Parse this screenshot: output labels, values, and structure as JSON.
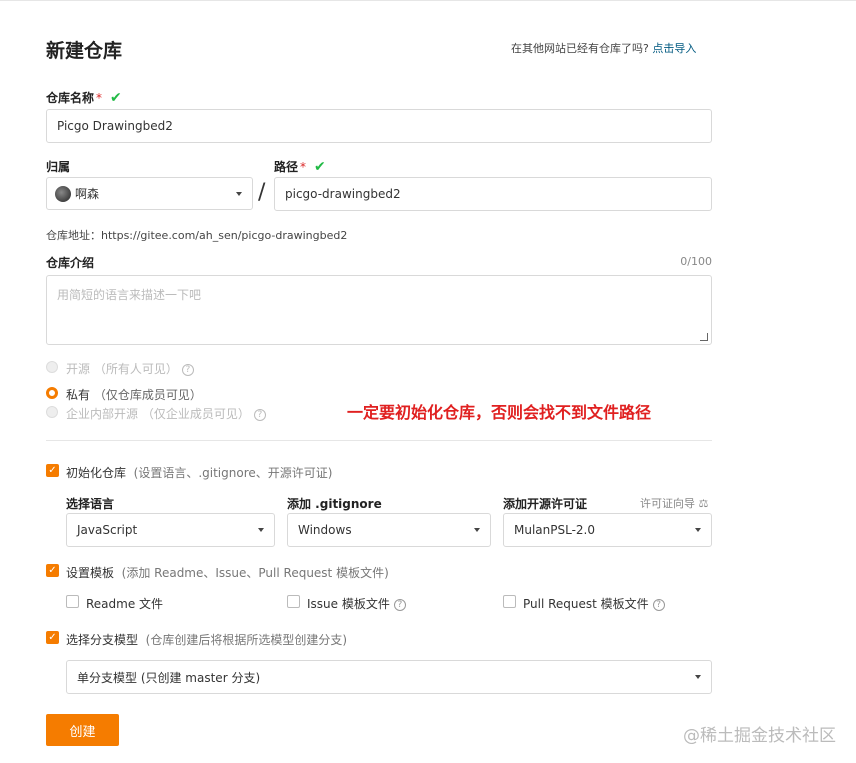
{
  "page": {
    "title": "新建仓库",
    "import_text": "在其他网站已经有仓库了吗?",
    "import_link": "点击导入"
  },
  "repo_name": {
    "label": "仓库名称",
    "required_mark": "*",
    "value": "Picgo Drawingbed2"
  },
  "owner": {
    "label": "归属",
    "value": "啊森"
  },
  "slash": "/",
  "path": {
    "label": "路径",
    "required_mark": "*",
    "value": "picgo-drawingbed2"
  },
  "repo_url": "仓库地址：https://gitee.com/ah_sen/picgo-drawingbed2",
  "intro": {
    "label": "仓库介绍",
    "counter": "0/100",
    "placeholder": "用简短的语言来描述一下吧"
  },
  "visibility": {
    "options": [
      {
        "label": "开源",
        "note": "（所有人可见）",
        "selected": false,
        "disabled": true
      },
      {
        "label": "私有",
        "note": "（仅仓库成员可见）",
        "selected": true,
        "disabled": false
      },
      {
        "label": "企业内部开源",
        "note": "（仅企业成员可见）",
        "selected": false,
        "disabled": true
      }
    ]
  },
  "annotation": "一定要初始化仓库，否则会找不到文件路径",
  "init_repo": {
    "label": "初始化仓库",
    "note": "(设置语言、.gitignore、开源许可证)",
    "checked": true
  },
  "language": {
    "label": "选择语言",
    "value": "JavaScript"
  },
  "gitignore": {
    "label": "添加 .gitignore",
    "value": "Windows"
  },
  "license": {
    "label": "添加开源许可证",
    "guide": "许可证向导",
    "value": "MulanPSL-2.0"
  },
  "template": {
    "label": "设置模板",
    "note": "(添加 Readme、Issue、Pull Request 模板文件)",
    "checked": true,
    "options": [
      {
        "label": "Readme 文件"
      },
      {
        "label": "Issue 模板文件"
      },
      {
        "label": "Pull Request 模板文件"
      }
    ]
  },
  "branch": {
    "label": "选择分支模型",
    "note": "(仓库创建后将根据所选模型创建分支)",
    "checked": true,
    "value": "单分支模型 (只创建 master 分支)"
  },
  "create_button": "创建",
  "watermark": "@稀土掘金技术社区",
  "colors": {
    "accent": "#f57c00",
    "success": "#21ba45",
    "required": "#db2828",
    "annotation": "#e02020",
    "link": "#005980"
  }
}
